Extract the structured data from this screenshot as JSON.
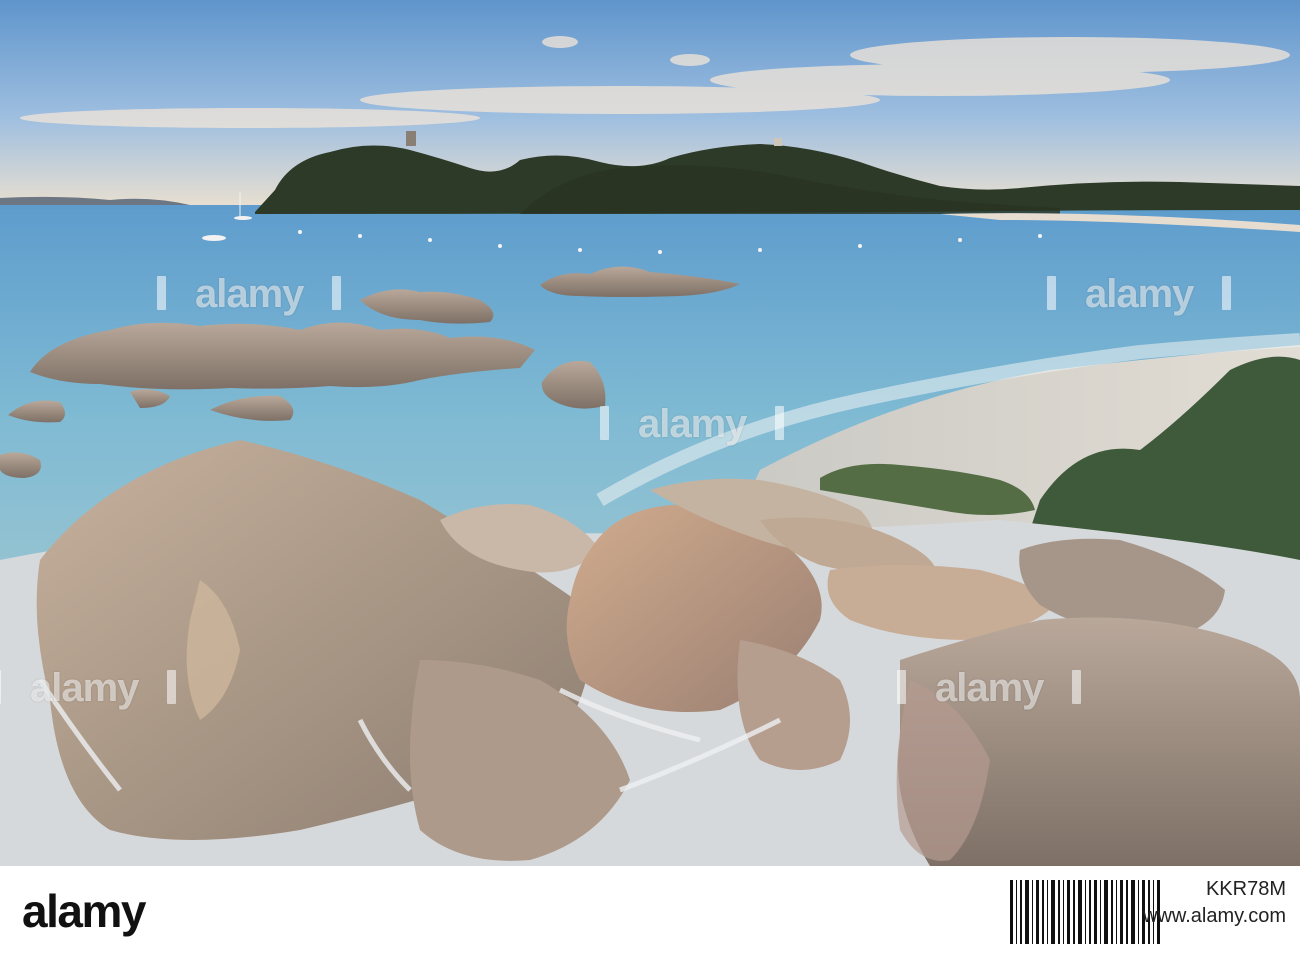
{
  "watermark": {
    "text": "alamy"
  },
  "footer": {
    "brand": "alamy",
    "stock_id": "KKR78M",
    "url": "www.alamy.com"
  },
  "colors": {
    "sky_top": "#6fa1d2",
    "sky_horizon": "#e8dccb",
    "sea": "#7fb3cf",
    "hill": "#2f3a2a",
    "rock": "#b9a693",
    "sand": "#d9d6d0"
  }
}
